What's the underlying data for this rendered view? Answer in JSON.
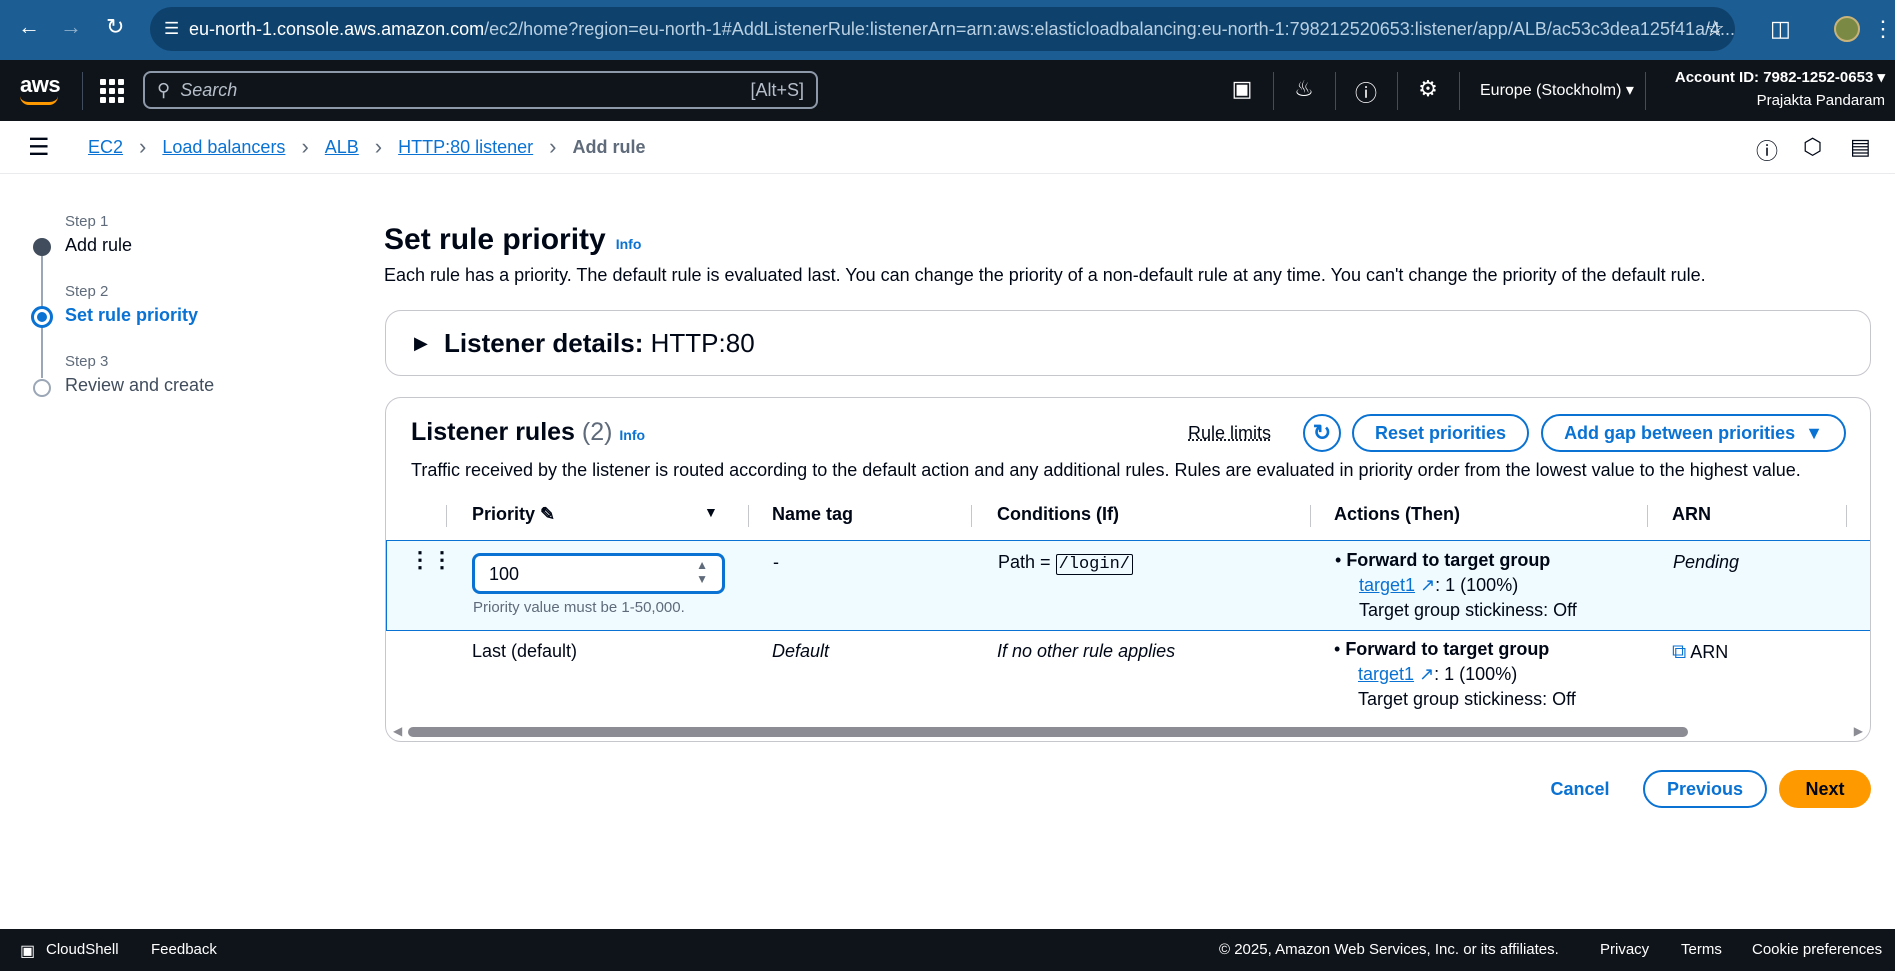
{
  "browser": {
    "url_host": "eu-north-1.console.aws.amazon.com",
    "url_path": "/ec2/home?region=eu-north-1#AddListenerRule:listenerArn=arn:aws:elasticloadbalancing:eu-north-1:798212520653:listener/app/ALB/ac53c3dea125f41a/4..."
  },
  "topnav": {
    "logo": "aws",
    "search_placeholder": "Search",
    "search_shortcut": "[Alt+S]",
    "region": "Europe (Stockholm)",
    "account_id": "Account ID: 7982-1252-0653",
    "user": "Prajakta Pandaram"
  },
  "breadcrumb": {
    "items": [
      "EC2",
      "Load balancers",
      "ALB",
      "HTTP:80 listener"
    ],
    "current": "Add rule"
  },
  "steps": [
    {
      "small": "Step 1",
      "label": "Add rule"
    },
    {
      "small": "Step 2",
      "label": "Set rule priority"
    },
    {
      "small": "Step 3",
      "label": "Review and create"
    }
  ],
  "page": {
    "title": "Set rule priority",
    "info": "Info",
    "description": "Each rule has a priority. The default rule is evaluated last. You can change the priority of a non-default rule at any time. You can't change the priority of the default rule."
  },
  "listener_details": {
    "label": "Listener details:",
    "value": "HTTP:80"
  },
  "listener_rules": {
    "title": "Listener rules",
    "count": "(2)",
    "info": "Info",
    "rule_limits": "Rule limits",
    "reset_label": "Reset priorities",
    "gap_label": "Add gap between priorities",
    "description": "Traffic received by the listener is routed according to the default action and any additional rules. Rules are evaluated in priority order from the lowest value to the highest value.",
    "columns": [
      "Priority",
      "Name tag",
      "Conditions (If)",
      "Actions (Then)",
      "ARN"
    ],
    "rows": [
      {
        "priority": "100",
        "priority_hint": "Priority value must be 1-50,000.",
        "name_tag": "-",
        "condition_prefix": "Path =",
        "condition_value": "/login/",
        "action_title": "Forward to target group",
        "target": "target1",
        "target_weight": ": 1 (100%)",
        "stickiness": "Target group stickiness: Off",
        "arn": "Pending"
      },
      {
        "priority": "Last (default)",
        "name_tag": "Default",
        "condition": "If no other rule applies",
        "action_title": "Forward to target group",
        "target": "target1",
        "target_weight": ": 1 (100%)",
        "stickiness": "Target group stickiness: Off",
        "arn": "ARN"
      }
    ]
  },
  "actions": {
    "cancel": "Cancel",
    "previous": "Previous",
    "next": "Next"
  },
  "footer": {
    "cloudshell": "CloudShell",
    "feedback": "Feedback",
    "copyright": "© 2025, Amazon Web Services, Inc. or its affiliates.",
    "privacy": "Privacy",
    "terms": "Terms",
    "cookies": "Cookie preferences"
  },
  "colors": {
    "link": "#0972d3",
    "primary_button": "#ff9900",
    "nav_bg": "#0f141a",
    "browser_bar": "#1c5d93"
  }
}
